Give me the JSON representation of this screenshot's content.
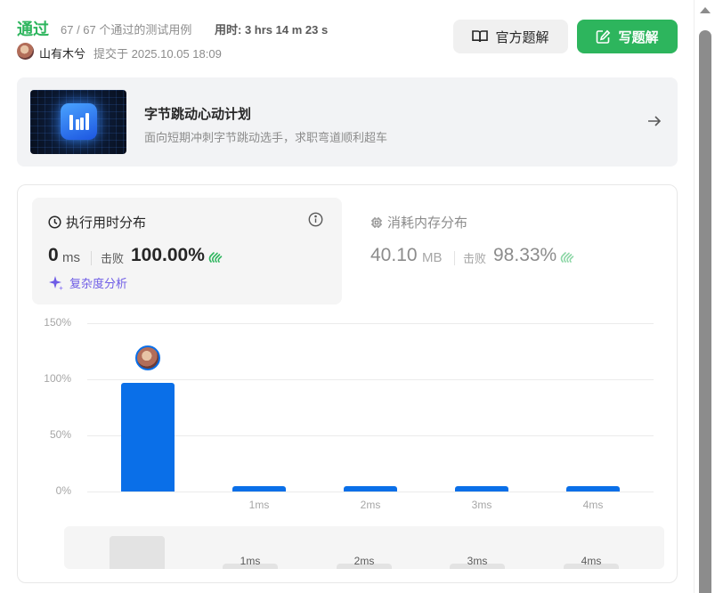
{
  "header": {
    "status": "通过",
    "cases": "67 / 67 个通过的测试用例",
    "runtime_label": "用时:",
    "runtime_value": "3 hrs 14 m 23 s",
    "author": "山有木兮",
    "submitted": "提交于 2025.10.05 18:09",
    "official_solution_label": "官方题解",
    "write_solution_label": "写题解"
  },
  "banner": {
    "title": "字节跳动心动计划",
    "description": "面向短期冲刺字节跳动选手，求职弯道顺利超车"
  },
  "runtime_card": {
    "title": "执行用时分布",
    "value": "0",
    "unit": "ms",
    "beat_label": "击败",
    "beat_value": "100.00%",
    "complexity_label": "复杂度分析"
  },
  "memory": {
    "title": "消耗内存分布",
    "value": "40.10",
    "unit": "MB",
    "beat_label": "击败",
    "beat_value": "98.33%"
  },
  "chart_data": {
    "type": "bar",
    "categories": [
      "0ms",
      "1ms",
      "2ms",
      "3ms",
      "4ms"
    ],
    "tick_labels": [
      "",
      "1ms",
      "2ms",
      "3ms",
      "4ms"
    ],
    "values": [
      97,
      5,
      5,
      5,
      5
    ],
    "ylim": [
      0,
      150
    ],
    "yticks": [
      "0%",
      "50%",
      "100%",
      "150%"
    ],
    "grid": true,
    "bar_color": "#0a6fe8"
  },
  "mini_chart": {
    "labels": [
      "",
      "1ms",
      "2ms",
      "3ms",
      "4ms"
    ],
    "values": [
      97,
      5,
      5,
      5,
      5
    ]
  },
  "colors": {
    "accent_green": "#2db55d",
    "bar_blue": "#0a6fe8",
    "complexity_purple": "#6e5ce6"
  }
}
